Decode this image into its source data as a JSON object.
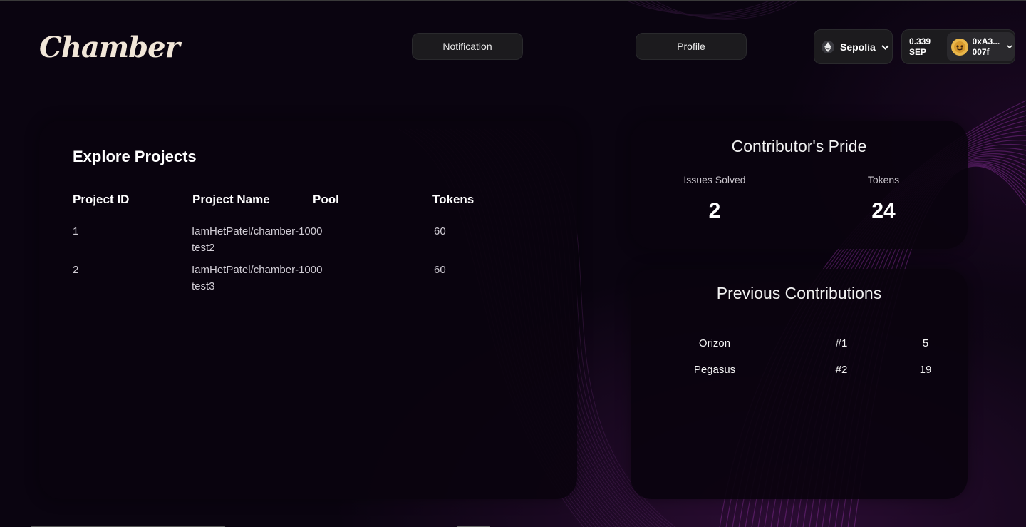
{
  "header": {
    "logo": "Chamber",
    "nav": {
      "notification": "Notification",
      "profile": "Profile"
    },
    "network": {
      "name": "Sepolia",
      "icon": "ethereum-icon"
    },
    "account": {
      "balance_amount": "0.339",
      "balance_unit": "SEP",
      "address_line1": "0xA3...",
      "address_line2": "007f"
    }
  },
  "explore": {
    "title": "Explore Projects",
    "columns": [
      "Project ID",
      "Project Name",
      "Pool",
      "Tokens"
    ],
    "rows": [
      {
        "id": "1",
        "name": "IamHetPatel/chamber-",
        "pool_line1": "1000",
        "pool_line2": "test2",
        "tokens": "60"
      },
      {
        "id": "2",
        "name": "IamHetPatel/chamber-",
        "pool_line1": "1000",
        "pool_line2": "test3",
        "tokens": "60"
      }
    ]
  },
  "pride": {
    "title": "Contributor's Pride",
    "issues_label": "Issues Solved",
    "issues_value": "2",
    "tokens_label": "Tokens",
    "tokens_value": "24"
  },
  "previous": {
    "title": "Previous Contributions",
    "rows": [
      {
        "name": "Orizon",
        "rank": "#1",
        "value": "5"
      },
      {
        "name": "Pegasus",
        "rank": "#2",
        "value": "19"
      }
    ]
  },
  "colors": {
    "background": "#0a0410",
    "card": "#0a030e",
    "button": "#1c1b1e",
    "accent_wave": "#8a2d9a"
  }
}
